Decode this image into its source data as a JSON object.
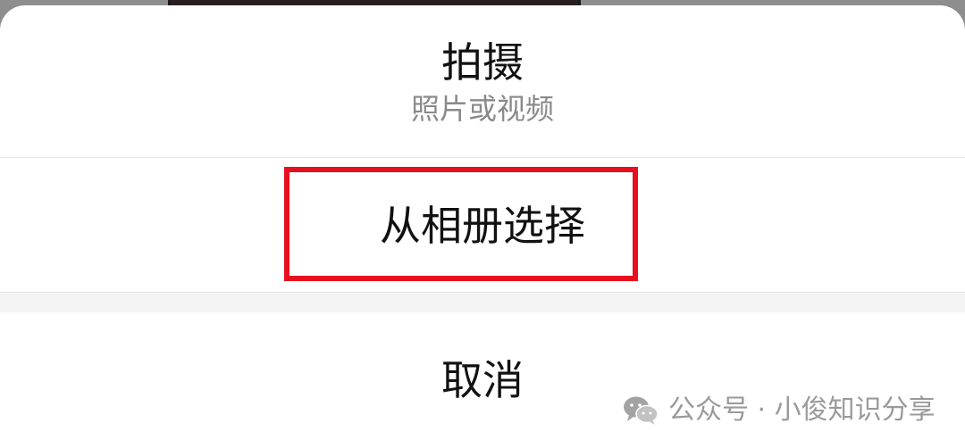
{
  "action_sheet": {
    "capture": {
      "title": "拍摄",
      "subtitle": "照片或视频"
    },
    "album": {
      "label": "从相册选择"
    },
    "cancel": {
      "label": "取消"
    }
  },
  "watermark": {
    "icon": "wechat-icon",
    "text": "公众号 · 小俊知识分享"
  },
  "colors": {
    "highlight": "#e8101e",
    "primary_text": "#111111",
    "secondary_text": "#8a8a8a"
  }
}
